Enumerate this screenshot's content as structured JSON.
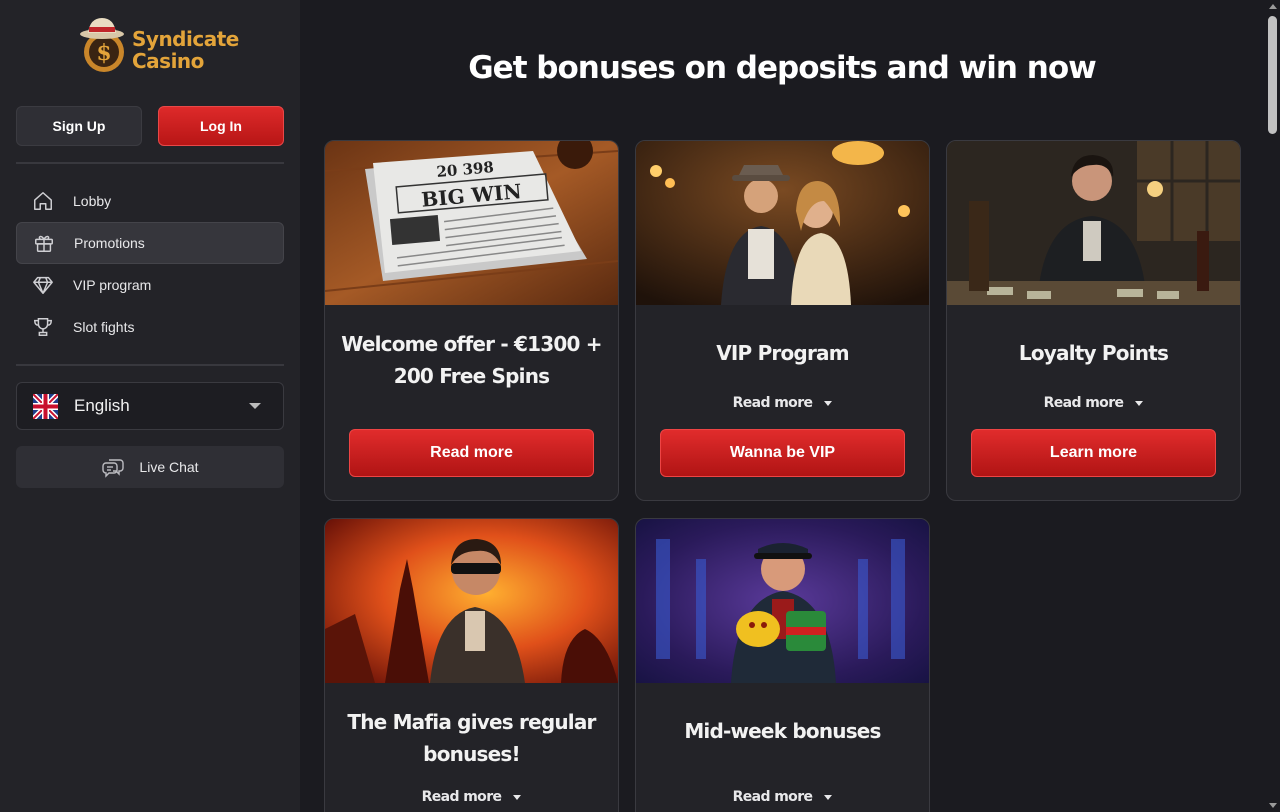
{
  "brand": {
    "name_line1": "Syndicate",
    "name_line2": "Casino"
  },
  "auth": {
    "signup_label": "Sign Up",
    "login_label": "Log In"
  },
  "nav": {
    "items": [
      {
        "label": "Lobby",
        "icon": "home-icon"
      },
      {
        "label": "Promotions",
        "icon": "gift-icon",
        "active": true
      },
      {
        "label": "VIP program",
        "icon": "diamond-icon"
      },
      {
        "label": "Slot fights",
        "icon": "trophy-icon"
      }
    ]
  },
  "language": {
    "selected": "English",
    "flag": "uk-flag-icon"
  },
  "live_chat": {
    "label": "Live Chat"
  },
  "main": {
    "title": "Get bonuses on deposits and win now",
    "cards": [
      {
        "title_line1": "Welcome offer - €1300 +",
        "title_line2": "200 Free Spins",
        "button": "Read more",
        "image_headline_number": "20 398",
        "image_headline": "BIG WIN"
      },
      {
        "title": "VIP Program",
        "read_more": "Read more",
        "button": "Wanna be VIP"
      },
      {
        "title": "Loyalty Points",
        "read_more": "Read more",
        "button": "Learn more"
      },
      {
        "title_line1": "The Mafia gives regular",
        "title_line2": "bonuses!",
        "read_more": "Read more"
      },
      {
        "title": "Mid-week bonuses",
        "read_more": "Read more"
      }
    ]
  },
  "colors": {
    "accent_red": "#d32020",
    "brand_gold": "#e3a43a",
    "background": "#1b1b20",
    "sidebar": "#232328"
  }
}
